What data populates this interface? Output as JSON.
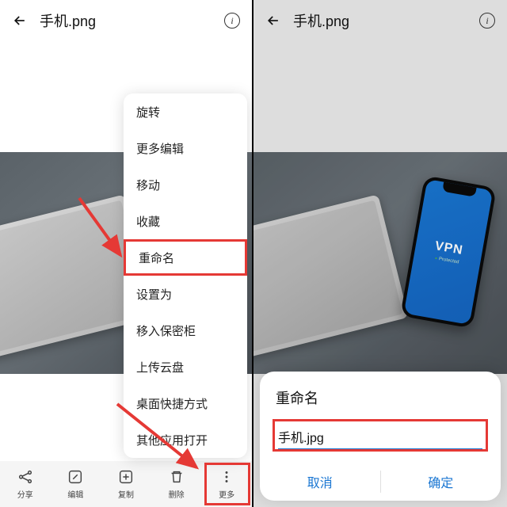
{
  "left": {
    "title": "手机.png",
    "menu": [
      "旋转",
      "更多编辑",
      "移动",
      "收藏",
      "重命名",
      "设置为",
      "移入保密柜",
      "上传云盘",
      "桌面快捷方式",
      "其他应用打开"
    ],
    "toolbar": [
      {
        "icon": "share",
        "label": "分享"
      },
      {
        "icon": "edit",
        "label": "编辑"
      },
      {
        "icon": "copy",
        "label": "复制"
      },
      {
        "icon": "delete",
        "label": "删除"
      },
      {
        "icon": "more",
        "label": "更多"
      }
    ]
  },
  "right": {
    "title": "手机.png",
    "phone_text": "VPN",
    "phone_sub": "Protected",
    "dialog": {
      "title": "重命名",
      "value": "手机.jpg",
      "cancel": "取消",
      "ok": "确定"
    }
  }
}
